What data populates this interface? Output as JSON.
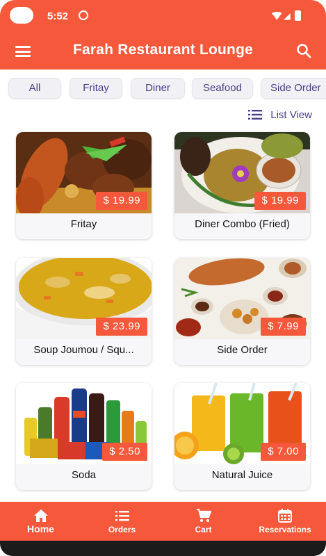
{
  "status": {
    "time": "5:52"
  },
  "appbar": {
    "title": "Farah Restaurant Lounge"
  },
  "categories": [
    "All",
    "Fritay",
    "Diner",
    "Seafood",
    "Side Order"
  ],
  "view_toggle": {
    "label": "List View"
  },
  "items": [
    {
      "name": "Fritay",
      "price": "$ 19.99"
    },
    {
      "name": "Diner Combo (Fried)",
      "price": "$ 19.99"
    },
    {
      "name": "Soup Joumou / Squ...",
      "price": "$ 23.99"
    },
    {
      "name": "Side Order",
      "price": "$ 7.99"
    },
    {
      "name": "Soda",
      "price": "$ 2.50"
    },
    {
      "name": "Natural Juice",
      "price": "$ 7.00"
    }
  ],
  "bottom_nav": [
    {
      "label": "Home",
      "icon": "home-icon",
      "active": true
    },
    {
      "label": "Orders",
      "icon": "list-icon",
      "active": false
    },
    {
      "label": "Cart",
      "icon": "cart-icon",
      "active": false
    },
    {
      "label": "Reservations",
      "icon": "calendar-icon",
      "active": false
    }
  ],
  "colors": {
    "primary": "#f5583b",
    "chip_text": "#4a3d8a",
    "chip_bg": "#f1f0f5"
  }
}
